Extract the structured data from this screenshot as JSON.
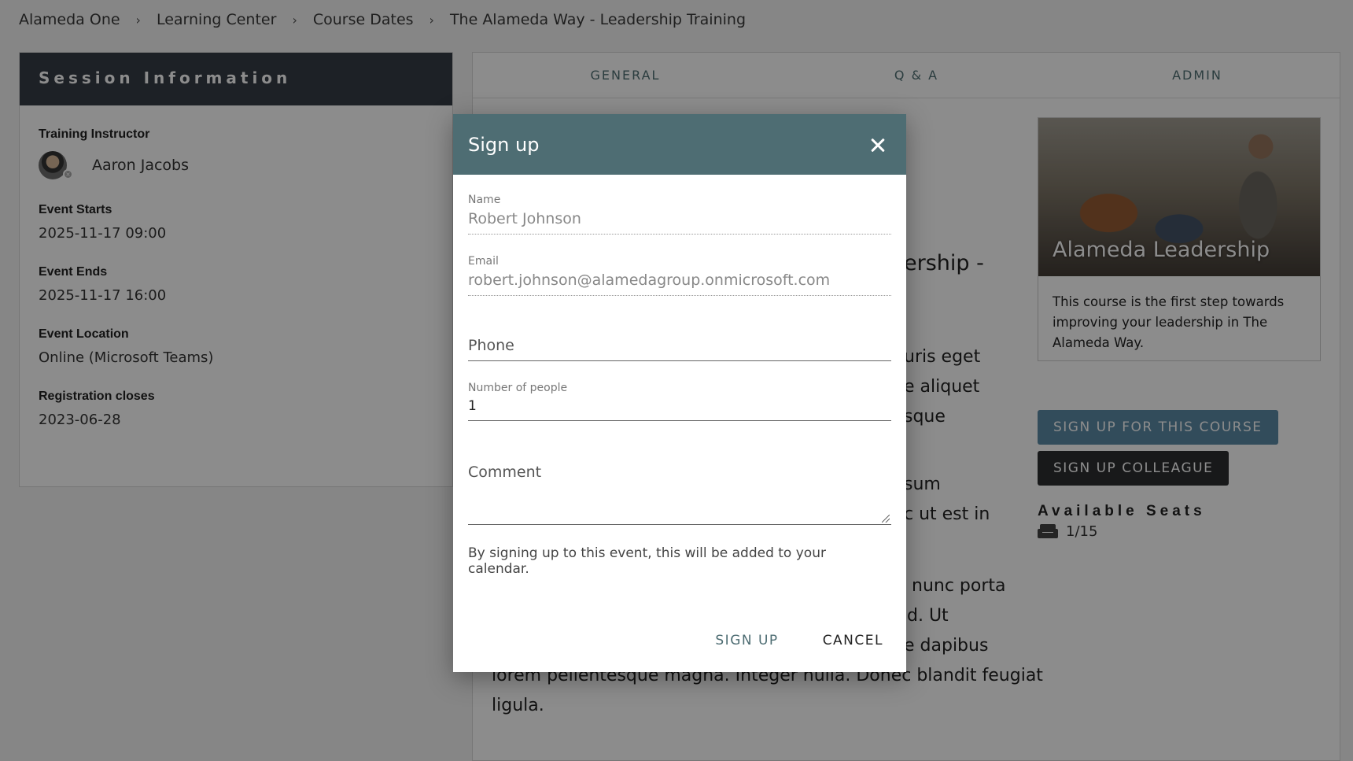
{
  "breadcrumb": [
    "Alameda One",
    "Learning Center",
    "Course Dates",
    "The Alameda Way - Leadership Training"
  ],
  "session": {
    "header": "Session Information",
    "instructor_label": "Training Instructor",
    "instructor_name": "Aaron Jacobs",
    "starts_label": "Event Starts",
    "starts_value": "2025-11-17 09:00",
    "ends_label": "Event Ends",
    "ends_value": "2025-11-17 16:00",
    "location_label": "Event Location",
    "location_value": "Online (Microsoft Teams)",
    "reg_label": "Registration closes",
    "reg_value": "2023-06-28"
  },
  "tabs": [
    "GENERAL",
    "Q & A",
    "ADMIN"
  ],
  "article": {
    "title_fragment": "ership -",
    "fragments": [
      "uris eget",
      "e aliquet",
      "sque",
      "sum",
      "c ut est in",
      "nunc porta",
      "d. Ut",
      "e dapibus",
      "lorem pellentesque magna. Integer nulla. Donec blandit feugiat",
      "ligula."
    ]
  },
  "promo": {
    "title": "Alameda Leadership",
    "text": "This course is the first step towards improving your leadership in The Alameda Way."
  },
  "buttons": {
    "signup_course": "SIGN UP FOR THIS COURSE",
    "signup_colleague": "SIGN UP COLLEAGUE"
  },
  "seats": {
    "title": "Available Seats",
    "value": "1/15"
  },
  "modal": {
    "title": "Sign up",
    "name_label": "Name",
    "name_value": "Robert Johnson",
    "email_label": "Email",
    "email_value": "robert.johnson@alamedagroup.onmicrosoft.com",
    "phone_placeholder": "Phone",
    "people_label": "Number of people",
    "people_value": "1",
    "comment_placeholder": "Comment",
    "notice": "By signing up to this event, this will be added to your calendar.",
    "signup_label": "SIGN UP",
    "cancel_label": "CANCEL"
  }
}
